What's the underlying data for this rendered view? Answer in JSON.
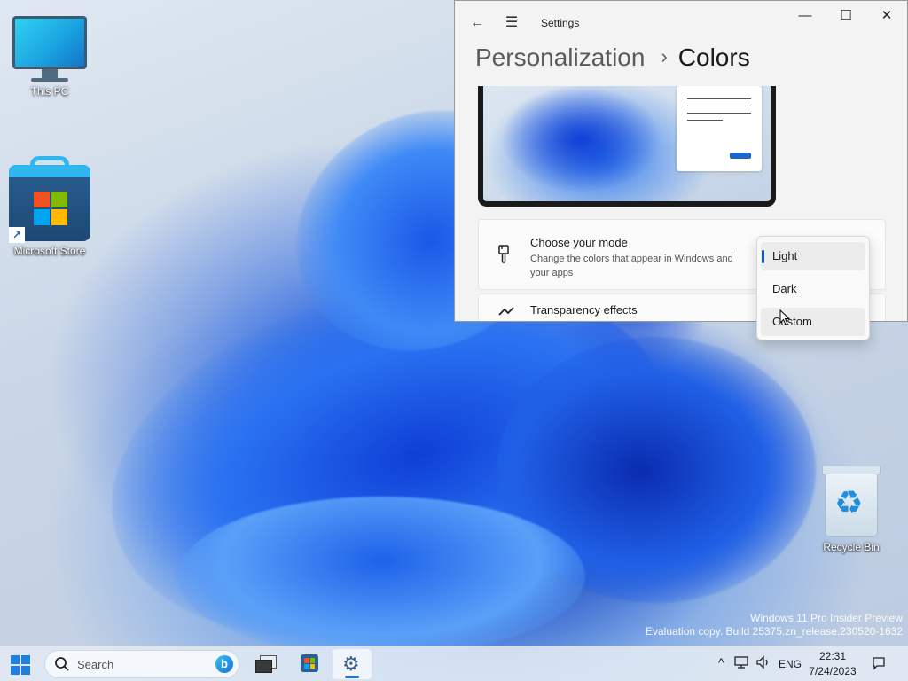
{
  "desktop": {
    "icons": [
      {
        "label": "This PC",
        "icon": "this-pc-monitor-icon"
      },
      {
        "label": "Microsoft Store",
        "icon": "microsoft-store-icon"
      },
      {
        "label": "Recycle Bin",
        "icon": "recycle-bin-icon"
      }
    ],
    "watermark": {
      "line1": "Windows 11 Pro Insider Preview",
      "line2": "Evaluation copy. Build 25375.zn_release.230520-1632"
    }
  },
  "settings_window": {
    "app_title": "Settings",
    "icons": {
      "back": "arrow-left-icon",
      "menu": "hamburger-icon",
      "minimize": "minimize-icon",
      "maximize": "maximize-icon",
      "close": "close-icon"
    },
    "glyphs": {
      "back": "←",
      "menu": "☰",
      "minimize": "—",
      "maximize": "☐",
      "close": "✕",
      "chevron": "›"
    },
    "breadcrumb": {
      "parent": "Personalization",
      "current": "Colors"
    },
    "mode_card": {
      "icon": "paintbrush-icon",
      "title": "Choose your mode",
      "description": "Change the colors that appear in Windows and your apps"
    },
    "transparency_card": {
      "icon": "transparency-icon",
      "title": "Transparency effects"
    }
  },
  "mode_dropdown": {
    "options": [
      "Light",
      "Dark",
      "Custom"
    ],
    "selected": "Light",
    "hovered": "Custom"
  },
  "taskbar": {
    "search_placeholder": "Search",
    "apps": [
      {
        "name": "task-view",
        "icon": "task-view-icon",
        "active": false
      },
      {
        "name": "microsoft-store",
        "icon": "microsoft-store-icon",
        "active": false
      },
      {
        "name": "settings",
        "icon": "gear-icon",
        "active": true
      }
    ],
    "tray": {
      "chevron": "^",
      "language": "ENG",
      "time": "22:31",
      "date": "7/24/2023"
    }
  },
  "colors": {
    "accent": "#0a5cc4",
    "ms_red": "#f25022",
    "ms_green": "#7fba00",
    "ms_blue": "#00a4ef",
    "ms_yellow": "#ffb900"
  }
}
